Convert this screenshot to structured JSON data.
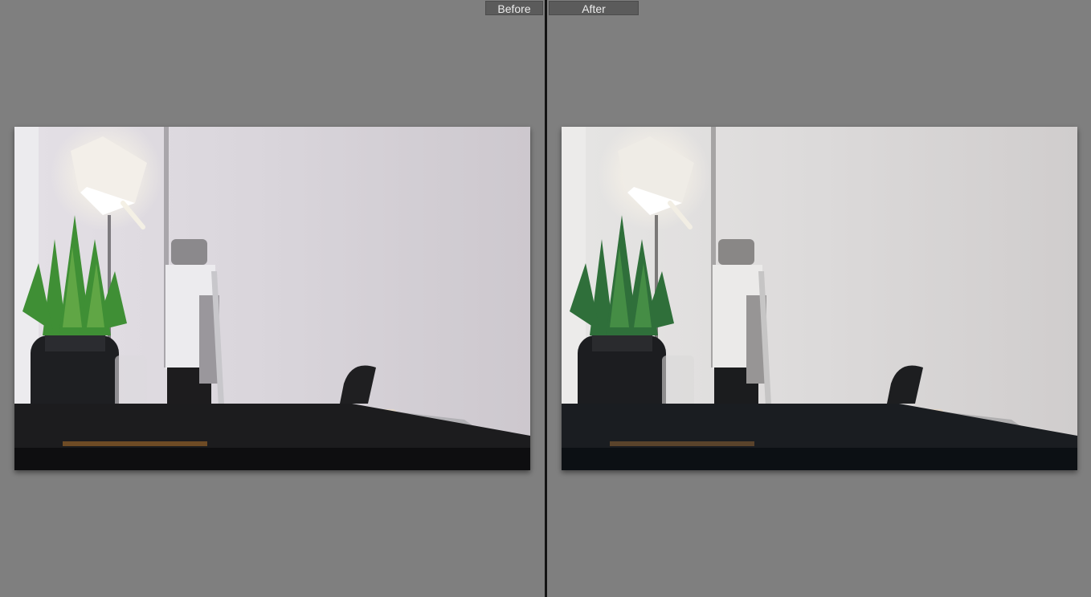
{
  "compare": {
    "before_label": "Before",
    "after_label": "After"
  },
  "colors": {
    "background": "#7f7f7f",
    "divider": "#141414",
    "label_bg": "#5b5b5b",
    "label_text": "#ececec"
  },
  "photos": {
    "before": {
      "wall": "#d7d3d9",
      "wall_dark": "#c9c4cb",
      "desk": "#1c1c1e",
      "leaf": "#3f8f35"
    },
    "after": {
      "wall": "#dcdada",
      "wall_dark": "#cfcccc",
      "desk": "#1a1d21",
      "leaf": "#2f6f3a"
    }
  },
  "icons": [
    "desk-lamp",
    "plant-jar",
    "laptop",
    "pen",
    "headphones"
  ]
}
